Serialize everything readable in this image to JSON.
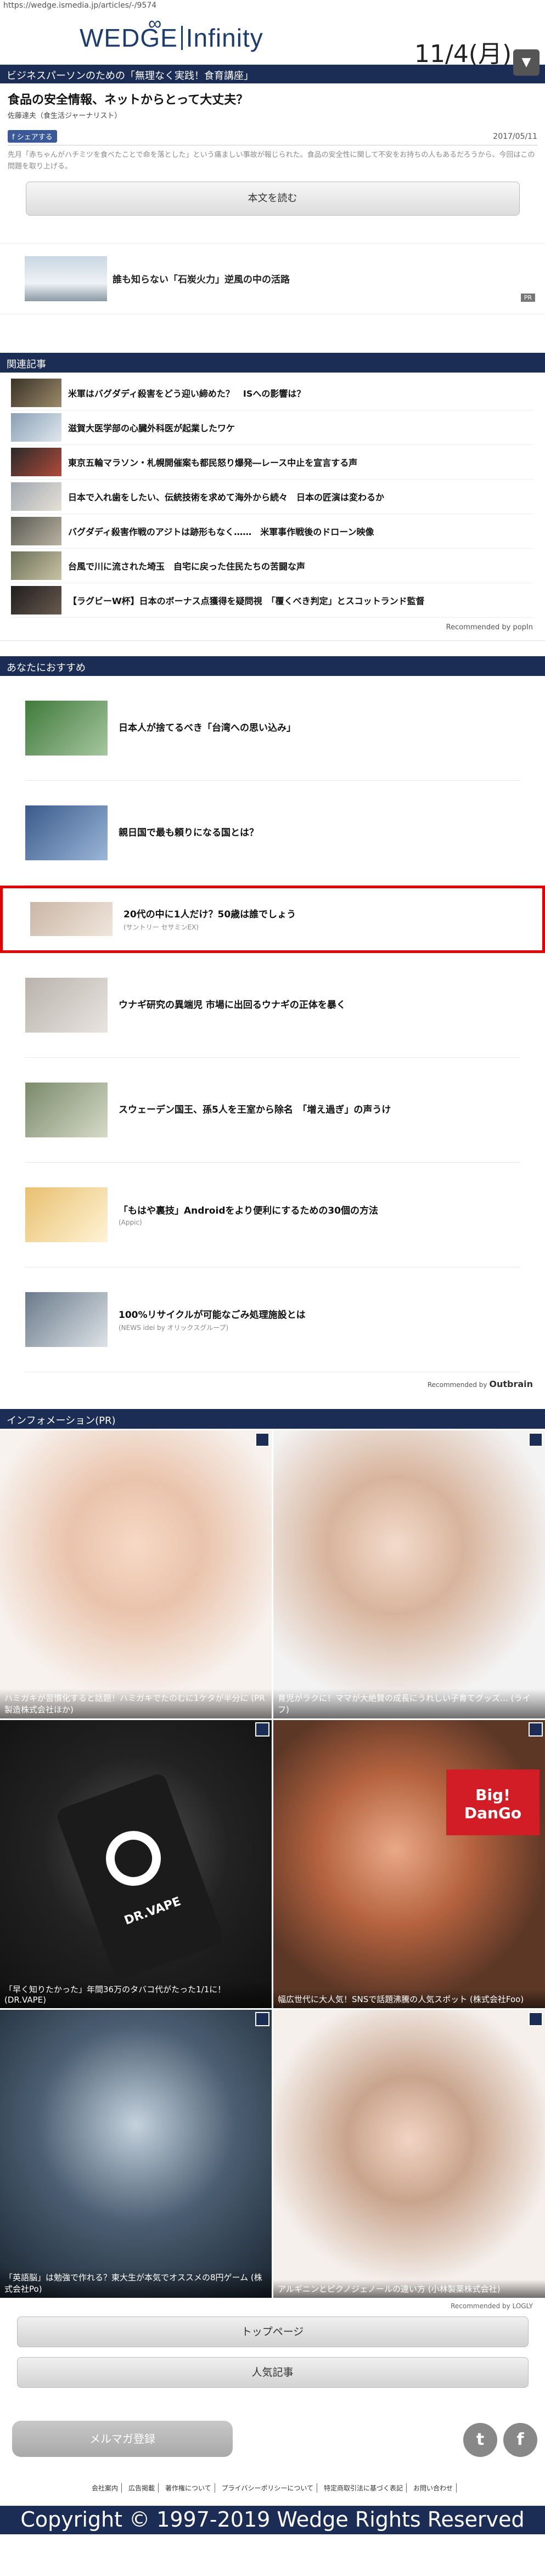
{
  "url": "https://wedge.ismedia.jp/articles/-/9574",
  "header": {
    "logo_left": "WEDGE",
    "logo_right": "Infinity",
    "date": "11/4(月)",
    "menu_icon": "chevron-down-icon"
  },
  "subbar": {
    "text": "ビジネスパーソンのための「無理なく実践！食育講座」"
  },
  "article": {
    "title": "食品の安全情報、ネットからとって大丈夫？",
    "author": "佐藤達夫（食生活ジャーナリスト）",
    "share_label": "シェアする",
    "date": "2017/05/11",
    "lead": "先月「赤ちゃんがハチミツを食べたことで命を落とした」という痛ましい事故が報じられた。食品の安全性に関して不安をお持ちの人もあるだろうから、今回はこの問題を取り上げる。",
    "read_more": "本文を読む"
  },
  "promo": {
    "title": "誰も知らない「石炭火力」逆風の中の活路",
    "badge": "PR"
  },
  "related": {
    "heading": "関連記事",
    "items": [
      "米軍はバグダディ殺害をどう迎い締めた？　ISへの影響は？",
      "滋賀大医学部の心臓外科医が起業したワケ",
      "東京五輪マラソン・札幌開催案も都民怒り爆発―レース中止を宣言する声",
      "日本で入れ歯をしたい、伝統技術を求めて海外から続々　日本の匠演は変わるか",
      "バグダディ殺害作戦のアジトは跡形もなく……　米軍事作戦後のドローン映像",
      "台風で川に流された埼玉　自宅に戻った住民たちの苦闘な声",
      "【ラグビーW杯】日本のボーナス点獲得を疑問視　「覆くべき判定」とスコットランド監督"
    ],
    "credit": "Recommended by popIn"
  },
  "recommend": {
    "heading": "あなたにおすすめ",
    "items": [
      {
        "title": "日本人が捨てるべき「台湾への思い込み」",
        "sponsor": ""
      },
      {
        "title": "親日国で最も頼りになる国とは？",
        "sponsor": ""
      },
      {
        "title": "20代の中に1人だけ？50歳は誰でしょう",
        "sponsor": "(サントリー セサミンEX)"
      },
      {
        "title": "ウナギ研究の異端児 市場に出回るウナギの正体を暴く",
        "sponsor": ""
      },
      {
        "title": "スウェーデン国王、孫5人を王室から除名　「増え過ぎ」の声うけ",
        "sponsor": ""
      },
      {
        "title": "「もはや裏技」Androidをより便利にするための30個の方法",
        "sponsor": "(Appic)"
      },
      {
        "title": "100%リサイクルが可能なごみ処理施設とは",
        "sponsor": "(NEWS idei by オリックスグループ)"
      }
    ],
    "credit_prefix": "Recommended by",
    "credit_brand": "Outbrain"
  },
  "info": {
    "heading": "インフォメーション(PR)",
    "items": [
      {
        "caption": "ハミガキが習慣化すると話題！ハミガキでたのむに1ケタが半分に (PR 製造株式会社ほか)"
      },
      {
        "caption": "育児がラクに！ママが大絶賛の成長にうれしい子育てグッズ… (ライフ)"
      },
      {
        "caption": "「早く知りたかった」年間36万のタバコ代がたった1/1に！ (DR.VAPE)"
      },
      {
        "caption": "幅広世代に大人気！SNSで話題沸騰の人気スポット (株式会社Foo)"
      },
      {
        "caption": "「英語脳」は勉強で作れる？東大生が本気でオススメの8円ゲーム (株式会社Po)"
      },
      {
        "caption": "アルギニンとピクノジェノールの違い方 (小林製薬株式会社)"
      }
    ],
    "credit": "Recommended by LOGLY"
  },
  "nav": {
    "top": "トップページ",
    "popular": "人気記事"
  },
  "footer": {
    "mail_button": "メルマガ登録",
    "links": [
      "会社案内",
      "広告掲載",
      "著作権について",
      "プライバシーポリシーについて",
      "特定商取引法に基づく表記",
      "お問い合わせ"
    ],
    "copyright": "Copyright © 1997-2019 Wedge Rights Reserved"
  }
}
